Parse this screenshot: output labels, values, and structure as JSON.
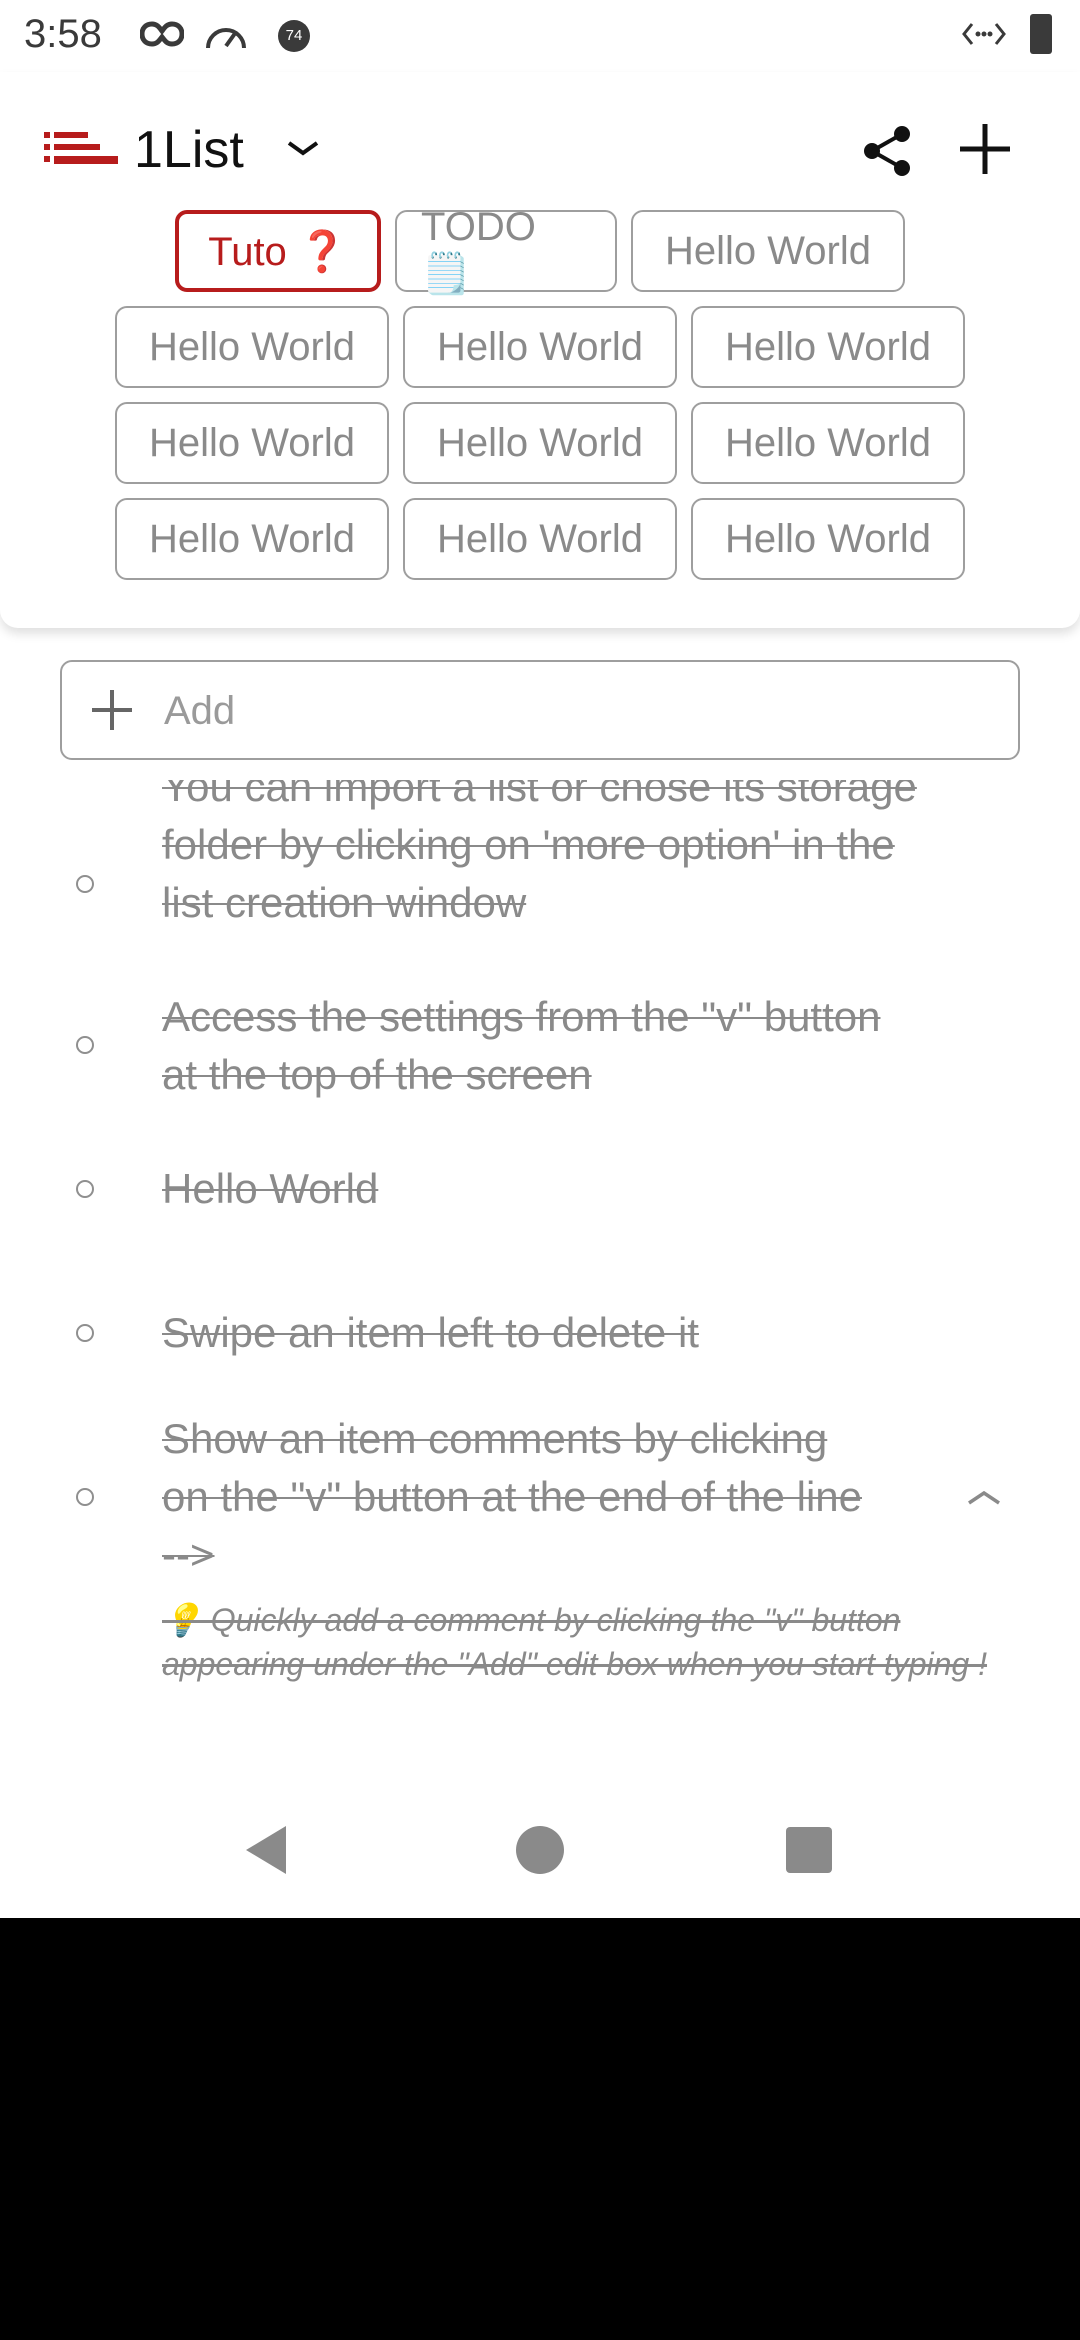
{
  "status_bar": {
    "time": "3:58",
    "badge": "74"
  },
  "header": {
    "title": "1List",
    "chips": [
      [
        "Tuto ❓",
        "TODO 🗒️",
        "Hello World"
      ],
      [
        "Hello World",
        "Hello World",
        "Hello World"
      ],
      [
        "Hello World",
        "Hello World",
        "Hello World"
      ],
      [
        "Hello World",
        "Hello World",
        "Hello World"
      ]
    ]
  },
  "add_field": {
    "placeholder": "Add",
    "value": ""
  },
  "items": [
    {
      "text": "You can import a list or chose its storage folder by clicking on 'more option' in the list creation window"
    },
    {
      "text": "Access the settings from the \"v\" button at the top of the screen"
    },
    {
      "text": "Hello World"
    },
    {
      "text": "Swipe an item left to delete it"
    },
    {
      "text": "Show an item comments by clicking on the \"v\" button at the end of the line -->",
      "comment": "💡 Quickly add a comment by clicking the \"v\" button appearing under the \"Add\" edit box when you start typing !"
    }
  ],
  "colors": {
    "accent": "#b71c1c",
    "muted": "#8a8a8a",
    "border": "#9e9e9e"
  }
}
